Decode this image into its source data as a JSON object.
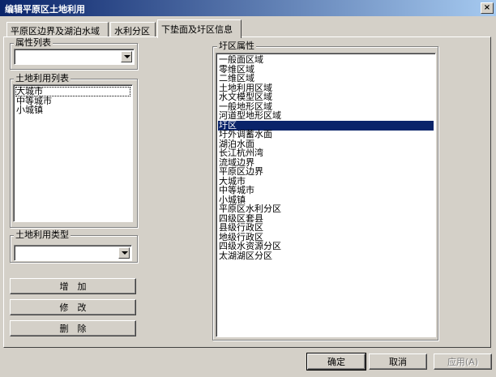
{
  "window": {
    "title": "编辑平原区土地利用",
    "close_glyph": "×"
  },
  "tabs": [
    {
      "label": "平原区边界及湖泊水域"
    },
    {
      "label": "水利分区"
    },
    {
      "label": "下垫面及圩区信息"
    }
  ],
  "left": {
    "attr_list": {
      "label": "属性列表",
      "value": ""
    },
    "landuse_list": {
      "label": "土地利用列表",
      "items": [
        "大城市",
        "中等城市",
        "小城镇"
      ],
      "focused_index": 0
    },
    "landuse_type": {
      "label": "土地利用类型",
      "value": ""
    },
    "buttons": {
      "add": "增　加",
      "modify": "修　改",
      "delete": "删　除"
    }
  },
  "right": {
    "label": "圩区属性",
    "items": [
      "一般面区域",
      "零维区域",
      "二维区域",
      "土地利用区域",
      "水文模型区域",
      "一般地形区域",
      "河道型地形区域",
      "圩区",
      "圩外调蓄水面",
      "湖泊水面",
      "长江杭州湾",
      "流域边界",
      "平原区边界",
      "大城市",
      "中等城市",
      "小城镇",
      "平原区水利分区",
      "四级区套县",
      "县级行政区",
      "地级行政区",
      "四级水资源分区",
      "太湖湖区分区"
    ],
    "selected_index": 7
  },
  "footer": {
    "ok": "确定",
    "cancel": "取消",
    "apply": "应用(A)"
  }
}
